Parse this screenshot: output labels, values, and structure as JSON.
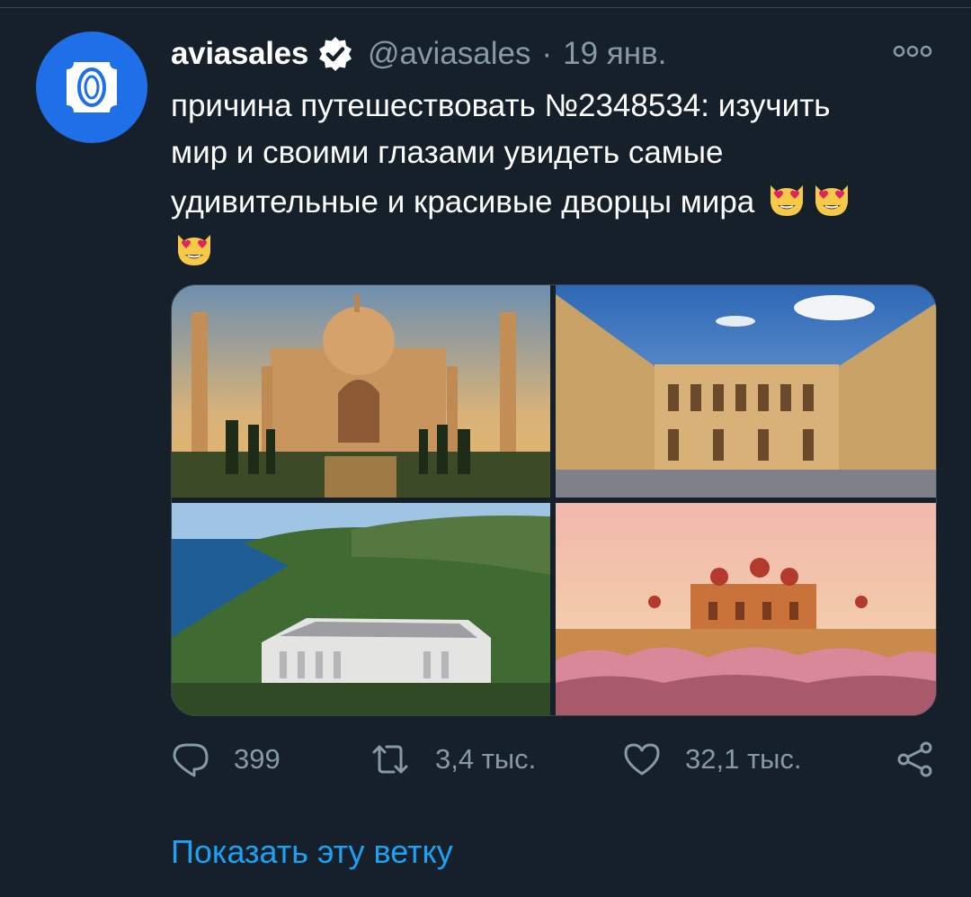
{
  "tweet": {
    "name": "aviasales",
    "handle": "@aviasales",
    "separator": "·",
    "date": "19 янв.",
    "text_line1": "причина путешествовать №2348534: изучить",
    "text_line2": "мир и своими глазами увидеть самые",
    "text_line3": "удивительные и красивые дворцы мира",
    "emoji": "heart-eyes-cat-emoji",
    "images": [
      {
        "name": "taj-mahal-photo"
      },
      {
        "name": "versailles-palace-photo"
      },
      {
        "name": "seaside-palace-photo"
      },
      {
        "name": "mysore-palace-photo"
      }
    ]
  },
  "actions": {
    "reply_count": "399",
    "retweet_count": "3,4 тыс.",
    "like_count": "32,1 тыс."
  },
  "show_thread": "Показать эту ветку",
  "colors": {
    "background": "#15202b",
    "secondary_text": "#8899a6",
    "link": "#1da1f2",
    "avatar": "#1f6fe8"
  }
}
